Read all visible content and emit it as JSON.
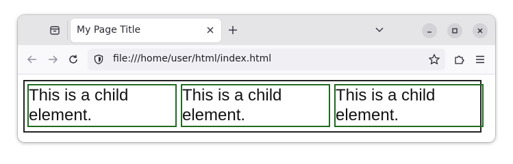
{
  "browser": {
    "tab": {
      "title": "My Page Title"
    },
    "url": "file:///home/user/html/index.html",
    "icons": {
      "tab_list": "tab-list-icon",
      "close_tab": "close-icon",
      "new_tab": "plus-icon",
      "list_all_tabs": "chevron-down-icon",
      "minimize": "minimize-icon",
      "maximize": "maximize-icon",
      "close_window": "close-icon",
      "back": "arrow-left-icon",
      "forward": "arrow-right-icon",
      "reload": "reload-icon",
      "site_info": "shield-icon",
      "bookmark": "star-icon",
      "extensions": "puzzle-icon",
      "menu": "hamburger-icon"
    }
  },
  "page": {
    "children": [
      {
        "text": "This is a child element."
      },
      {
        "text": "This is a child element."
      },
      {
        "text": "This is a child element."
      }
    ],
    "colors": {
      "parent_border": "#222222",
      "child_border": "#1f6b1f"
    }
  }
}
